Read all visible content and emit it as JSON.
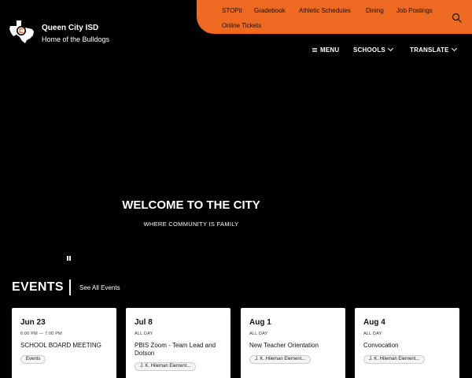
{
  "site": {
    "name": "Queen City ISD",
    "tagline": "Home of the Bulldogs"
  },
  "quick_links": [
    "STOPit",
    "Gradebook",
    "Athletic Schedules",
    "Dining",
    "Job Postings",
    "Online Tickets"
  ],
  "main_nav": {
    "menu": "MENU",
    "schools": "SCHOOLS",
    "translate": "TRANSLATE"
  },
  "hero": {
    "title": "WELCOME TO THE CITY",
    "subtitle": "WHERE COMMUNITY IS FAMILY"
  },
  "events": {
    "heading": "EVENTS",
    "see_all": "See All Events",
    "items": [
      {
        "date": "Jun 23",
        "time": "6:00 PM — 7:00 PM",
        "title": "SCHOOL BOARD MEETING",
        "tag": "Events"
      },
      {
        "date": "Jul 8",
        "time": "ALL DAY",
        "title": "PBIS Zoom - Team Lead and Dotson",
        "tag": "J. K. Hileman Element..."
      },
      {
        "date": "Aug 1",
        "time": "ALL DAY",
        "title": "New Teacher Orientation",
        "tag": "J. K. Hileman Element..."
      },
      {
        "date": "Aug 4",
        "time": "ALL DAY",
        "title": "Convocation",
        "tag": "J. K. Hileman Element..."
      }
    ]
  },
  "colors": {
    "accent": "#ee6a21",
    "background": "#000000",
    "card": "#ffffff"
  },
  "icons": {
    "logo": "texas-bulldog-logo",
    "search": "search-icon",
    "menu": "hamburger-icon",
    "dropdown": "chevron-down-icon",
    "pause": "pause-icon"
  }
}
